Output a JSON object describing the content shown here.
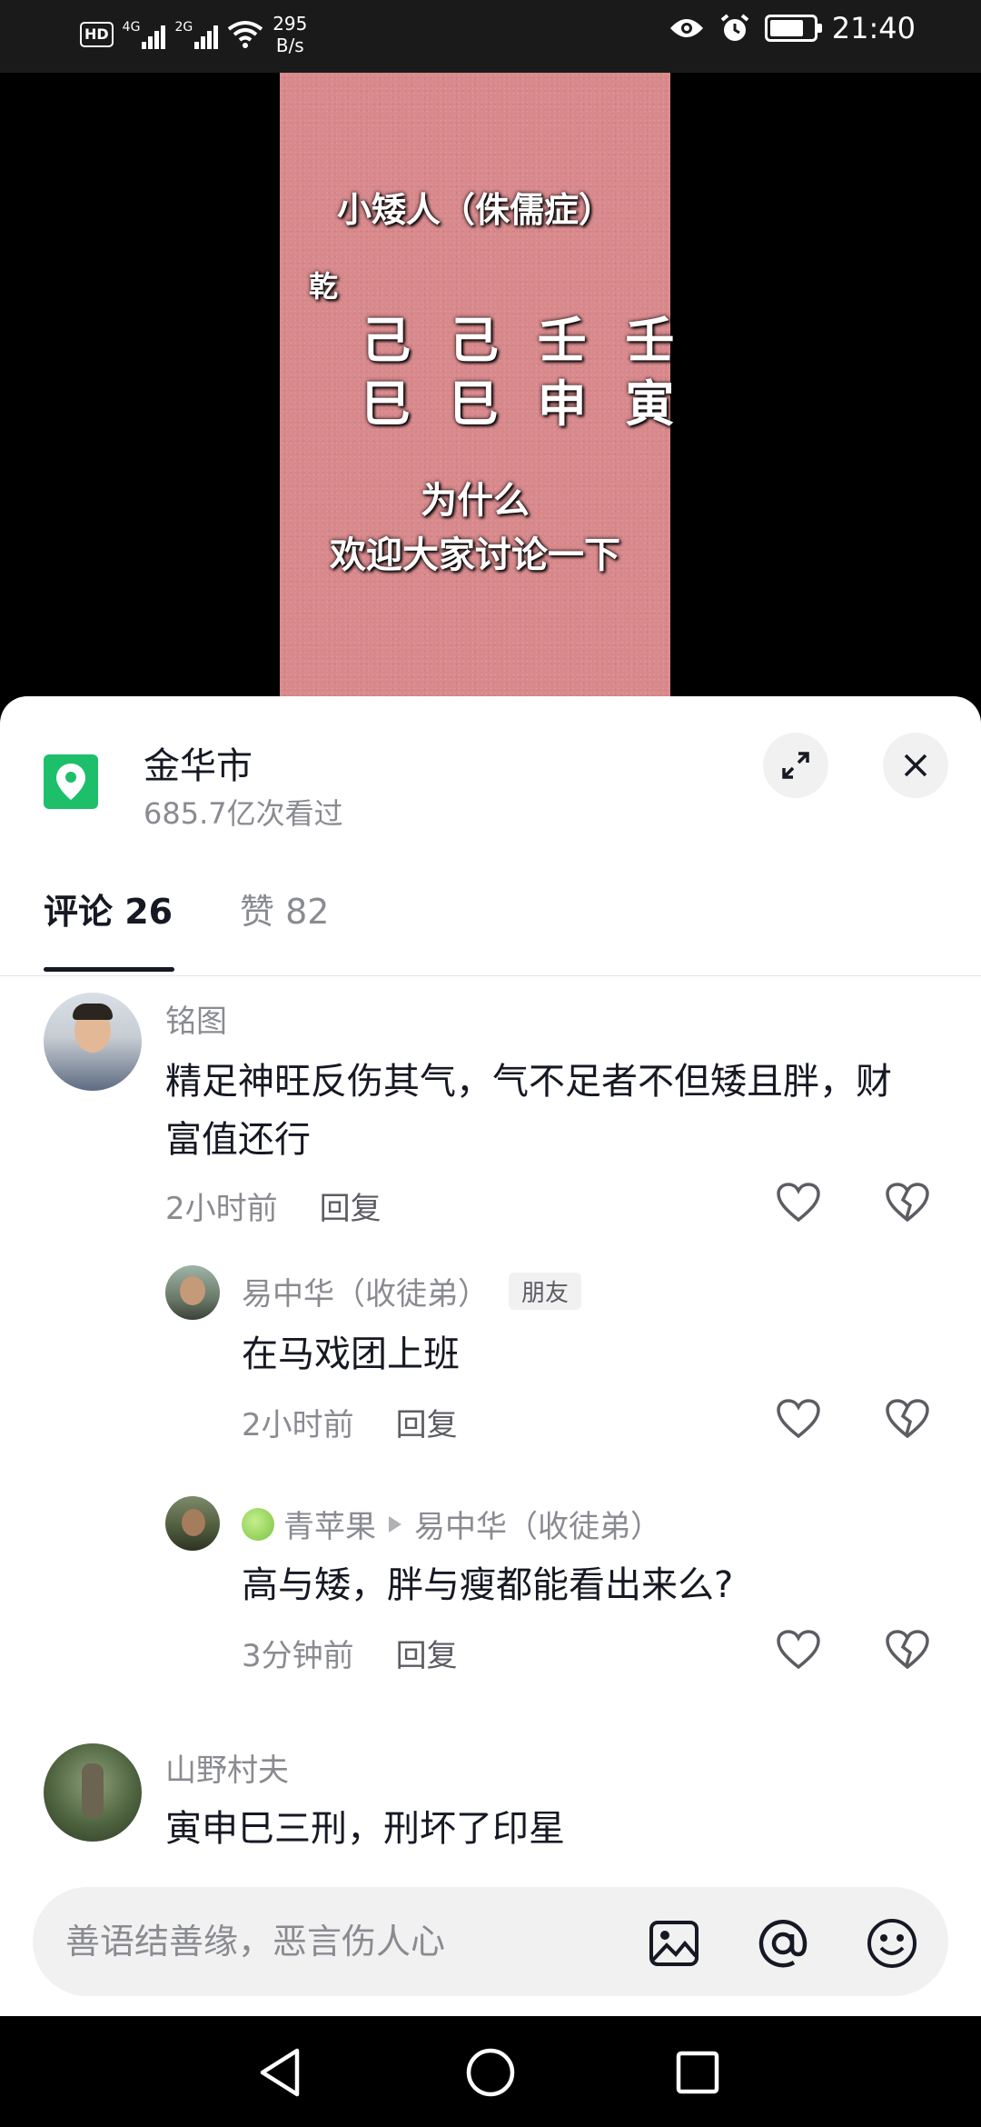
{
  "status_bar": {
    "hd": "HD",
    "sim1_gen": "4G",
    "sim2_gen": "2G",
    "net_speed": "295",
    "net_speed_unit": "B/s",
    "time": "21:40",
    "icons": [
      "eye-icon",
      "alarm-icon",
      "battery-charging-icon"
    ]
  },
  "video": {
    "title": "小矮人（侏儒症）",
    "gender": "乾",
    "row1": "己 己 壬 壬",
    "row2": "巳 巳 申 寅",
    "question": "为什么",
    "invite": "欢迎大家讨论一下"
  },
  "location": {
    "name": "金华市",
    "views": "685.7亿次看过",
    "icon": "location-pin-icon"
  },
  "tabs": {
    "comments": "评论 26",
    "likes": "赞 82"
  },
  "comments": [
    {
      "user": "铭图",
      "text": "精足神旺反伤其气，气不足者不但矮且胖，财富值还行",
      "time": "2小时前",
      "reply": "回复"
    },
    {
      "user": "易中华（收徒弟）",
      "badge": "朋友",
      "text": "在马戏团上班",
      "time": "2小时前",
      "reply": "回复"
    },
    {
      "user": "青苹果",
      "reply_to": "易中华（收徒弟）",
      "text": "高与矮，胖与瘦都能看出来么?",
      "time": "3分钟前",
      "reply": "回复"
    },
    {
      "user": "山野村夫",
      "text": "寅申巳三刑，刑坏了印星"
    }
  ],
  "input": {
    "placeholder": "善语结善缘，恶言伤人心",
    "icons": [
      "image-icon",
      "mention-icon",
      "emoji-icon"
    ]
  },
  "nav": [
    "back-icon",
    "home-icon",
    "recents-icon"
  ],
  "colors": {
    "location_green": "#1dbf6b",
    "poster_pink": "#d8898c",
    "text_primary": "#161823",
    "text_secondary": "#8a8b91"
  }
}
